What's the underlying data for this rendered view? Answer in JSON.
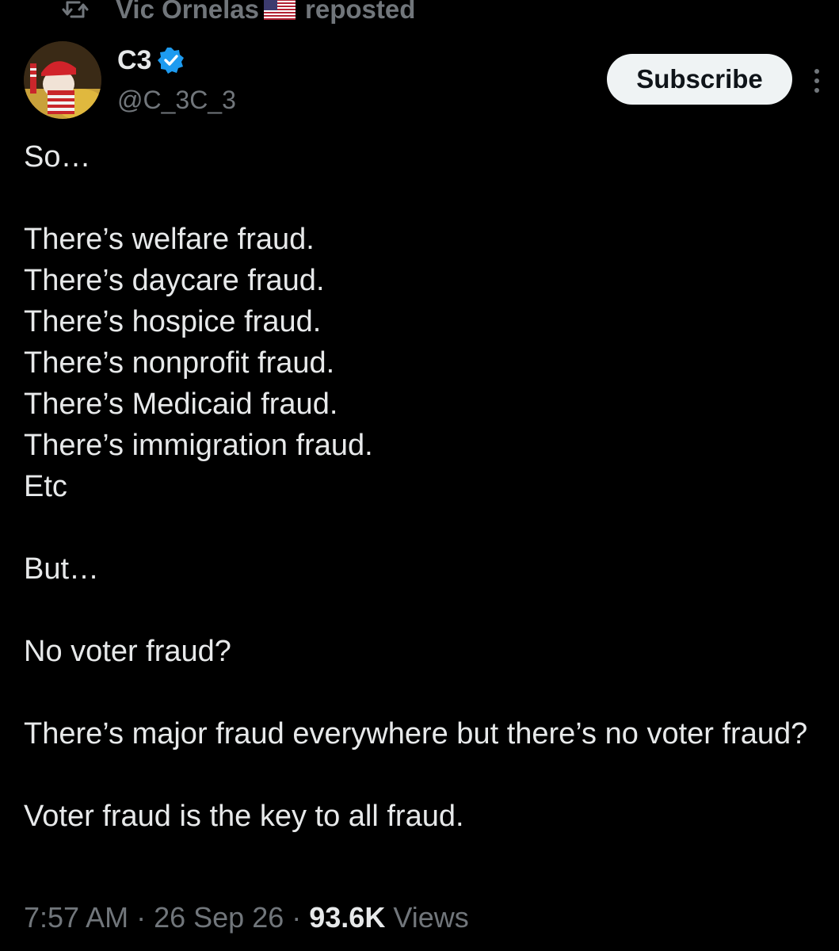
{
  "repost": {
    "reposter_name": "Vic Ornelas",
    "reposter_flag": "us-flag-icon",
    "label": "reposted"
  },
  "author": {
    "display_name": "C3",
    "handle": "@C_3C_3",
    "verified": true,
    "avatar": "avatar-image"
  },
  "actions": {
    "subscribe_label": "Subscribe",
    "more_icon": "more-vertical-icon"
  },
  "tweet": {
    "lines": [
      "So…",
      "",
      "There’s welfare fraud.",
      "There’s daycare fraud.",
      "There’s hospice fraud.",
      "There’s nonprofit fraud.",
      "There’s Medicaid fraud.",
      "There’s immigration fraud.",
      "Etc",
      "",
      "But…",
      "",
      "No voter fraud?",
      "",
      "There’s major fraud everywhere but there’s no voter fraud?",
      "",
      "Voter fraud is the key to all fraud."
    ]
  },
  "meta": {
    "time": "7:57 AM",
    "separator": "·",
    "date": "26 Sep 26",
    "views_count": "93.6K",
    "views_label": "Views"
  },
  "colors": {
    "background": "#000000",
    "primary_text": "#e7e9ea",
    "secondary_text": "#71767b",
    "verified_blue": "#1d9bf0",
    "button_bg": "#eff3f4"
  }
}
